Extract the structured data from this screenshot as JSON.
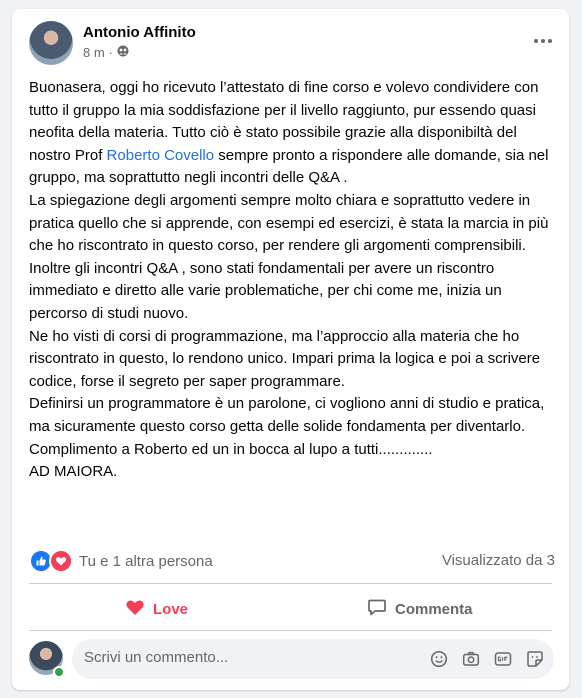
{
  "post": {
    "author": "Antonio Affinito",
    "time": "8 m",
    "separator": "·",
    "privacy_icon": "group-icon"
  },
  "body": {
    "p1_before": "Buonasera, oggi ho ricevuto l’attestato di fine corso e volevo condividere con tutto il gruppo la mia soddisfazione  per il livello raggiunto, pur essendo quasi neofita della materia. Tutto ciò è stato possibile grazie alla disponibiltà del nostro Prof ",
    "mention": "Roberto Covello",
    "p1_after": " sempre pronto a rispondere alle domande, sia nel gruppo, ma soprattutto negli incontri delle Q&A .",
    "p2": "La spiegazione degli argomenti sempre molto chiara e soprattutto vedere in pratica quello che si apprende, con esempi ed esercizi, è stata la marcia in più che ho riscontrato in questo corso, per rendere gli argomenti comprensibili.",
    "p3": "Inoltre gli incontri Q&A , sono stati fondamentali per avere un riscontro immediato e diretto alle varie problematiche, per chi come me, inizia un percorso di studi nuovo.",
    "p4": "Ne ho visti di corsi di programmazione, ma l’approccio alla materia che ho riscontrato in questo, lo rendono unico. Impari prima la logica e poi a scrivere codice, forse il segreto per saper programmare.",
    "p5": "Definirsi un programmatore è un parolone, ci vogliono anni di studio e pratica, ma sicuramente questo corso getta delle solide fondamenta per diventarlo.",
    "p6": "Complimento a Roberto ed un in bocca al lupo a tutti.............",
    "p7": "AD MAIORA."
  },
  "footer": {
    "reactions_text": "Tu e 1 altra persona",
    "views_text": "Visualizzato da 3",
    "love_label": "Love",
    "comment_label": "Commenta"
  },
  "comment": {
    "placeholder": "Scrivi un commento..."
  },
  "colors": {
    "love": "#f33e58",
    "like": "#1877f2",
    "mention": "#216fdb",
    "online": "#31a24c"
  }
}
